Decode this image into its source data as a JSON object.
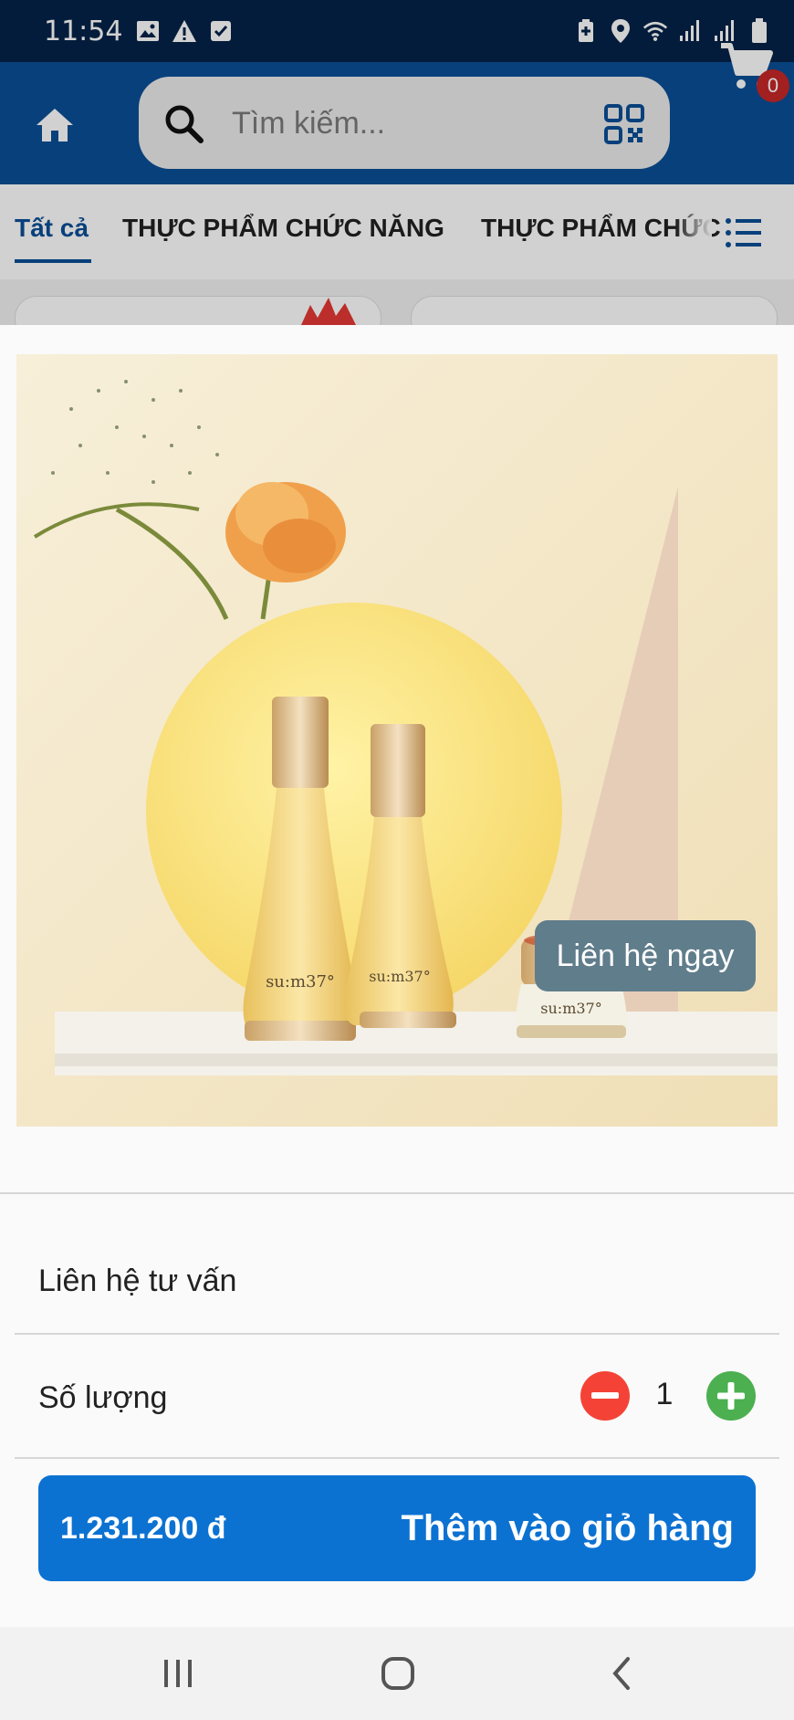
{
  "status_bar": {
    "time": "11:54",
    "left_icons": [
      "image-icon",
      "warning-icon",
      "checkbox-icon"
    ],
    "right_icons": [
      "battery-saver-icon",
      "location-icon",
      "wifi-icon",
      "signal-icon",
      "signal-icon",
      "battery-icon"
    ]
  },
  "header": {
    "search_placeholder": "Tìm kiếm...",
    "cart_count": "0",
    "colors": {
      "header_bg": "#0a4f96",
      "status_bg": "#052349"
    }
  },
  "tabs": [
    {
      "label": "Tất cả",
      "active": true
    },
    {
      "label": "THỰC PHẨM CHỨC NĂNG",
      "active": false
    },
    {
      "label": "THỰC PHẨM CHỨC",
      "active": false
    }
  ],
  "product": {
    "image_description_icon": "product-photo",
    "bottle_brand": "su:m37°"
  },
  "consult": {
    "label": "Liên hệ tư vấn",
    "button": "Liên hệ ngay"
  },
  "quantity": {
    "label": "Số lượng",
    "value": "1"
  },
  "add_to_cart": {
    "price": "1.231.200 đ",
    "label": "Thêm vào giỏ hàng"
  },
  "nav": {
    "icons": [
      "recent-apps-icon",
      "home-circle-icon",
      "back-icon"
    ]
  }
}
